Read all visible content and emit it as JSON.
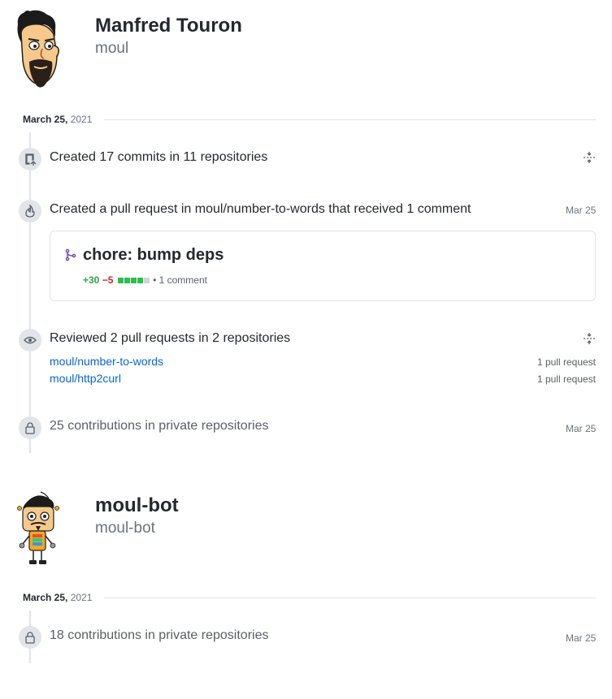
{
  "users": [
    {
      "name": "Manfred Touron",
      "login": "moul",
      "date_label": "March 25,",
      "date_year": "2021"
    },
    {
      "name": "moul-bot",
      "login": "moul-bot",
      "date_label": "March 25,",
      "date_year": "2021"
    }
  ],
  "events": {
    "commits": {
      "text": "Created 17 commits in 11 repositories"
    },
    "pull_request": {
      "prefix": "Created a pull request in",
      "repo": "moul/number-to-words",
      "suffix": "that received 1 comment",
      "date": "Mar 25",
      "card": {
        "title": "chore: bump deps",
        "additions": "+30",
        "deletions": "−5",
        "comments": "1 comment",
        "diff_squares": [
          "green",
          "green",
          "green",
          "green",
          "gray"
        ]
      }
    },
    "reviews": {
      "text": "Reviewed 2 pull requests in 2 repositories",
      "repos": [
        {
          "name": "moul/number-to-words",
          "count": "1 pull request"
        },
        {
          "name": "moul/http2curl",
          "count": "1 pull request"
        }
      ]
    },
    "private1": {
      "text": "25 contributions in private repositories",
      "date": "Mar 25"
    },
    "private2": {
      "text": "18 contributions in private repositories",
      "date": "Mar 25"
    }
  },
  "colors": {
    "link": "#0366d6",
    "additions": "#28a745",
    "deletions": "#cb2431",
    "pr_icon": "#6f42c1",
    "diff_green": "#2cbe4e",
    "diff_gray": "#d1d5da"
  },
  "icons": {
    "commits": "repo-push-icon",
    "pull_request": "flame-icon",
    "review": "eye-icon",
    "private": "lock-icon",
    "toggle": "fold-icon",
    "pr_merged": "git-merge-icon"
  }
}
